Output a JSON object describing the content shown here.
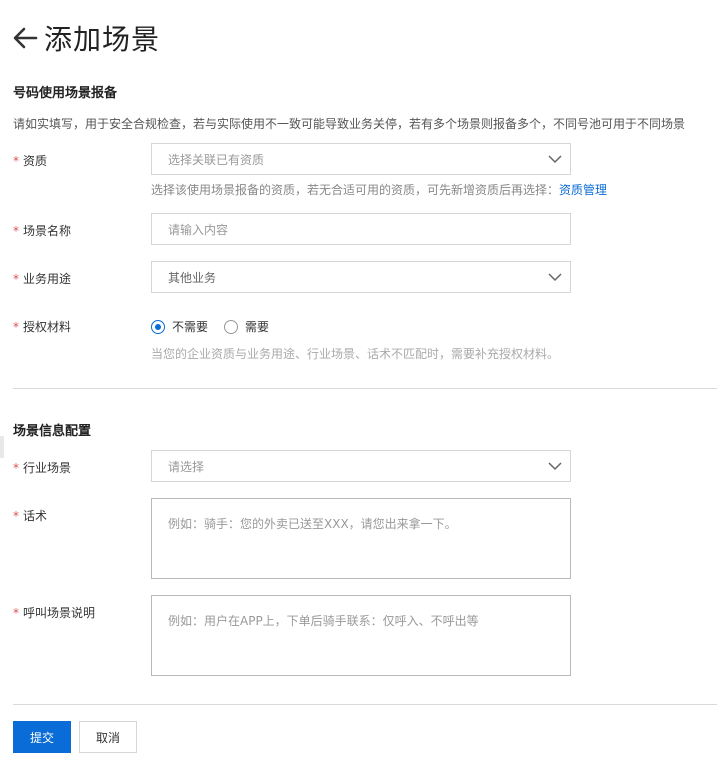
{
  "header": {
    "title": "添加场景",
    "back_icon": "arrow-left-icon"
  },
  "section1": {
    "title": "号码使用场景报备",
    "description": "请如实填写，用于安全合规检查，若与实际使用不一致可能导致业务关停，若有多个场景则报备多个，不同号池可用于不同场景"
  },
  "fields": {
    "qualification": {
      "label": "资质",
      "placeholder": "选择关联已有资质",
      "hint": "选择该使用场景报备的资质，若无合适可用的资质，可先新增资质后再选择：",
      "hint_link": "资质管理"
    },
    "scene_name": {
      "label": "场景名称",
      "placeholder": "请输入内容"
    },
    "business_use": {
      "label": "业务用途",
      "value": "其他业务"
    },
    "authorization": {
      "label": "授权材料",
      "options": [
        "不需要",
        "需要"
      ],
      "selected": "不需要",
      "hint": "当您的企业资质与业务用途、行业场景、话术不匹配时，需要补充授权材料。"
    }
  },
  "section2": {
    "title": "场景信息配置"
  },
  "fields2": {
    "industry": {
      "label": "行业场景",
      "placeholder": "请选择"
    },
    "script": {
      "label": "话术",
      "placeholder": "例如：骑手：您的外卖已送至XXX，请您出来拿一下。"
    },
    "call_desc": {
      "label": "呼叫场景说明",
      "placeholder": "例如：用户在APP上，下单后骑手联系：仅呼入、不呼出等"
    }
  },
  "buttons": {
    "submit": "提交",
    "cancel": "取消"
  },
  "colors": {
    "primary": "#0a6cd6",
    "required": "#d9534f"
  },
  "required_mark": "*"
}
